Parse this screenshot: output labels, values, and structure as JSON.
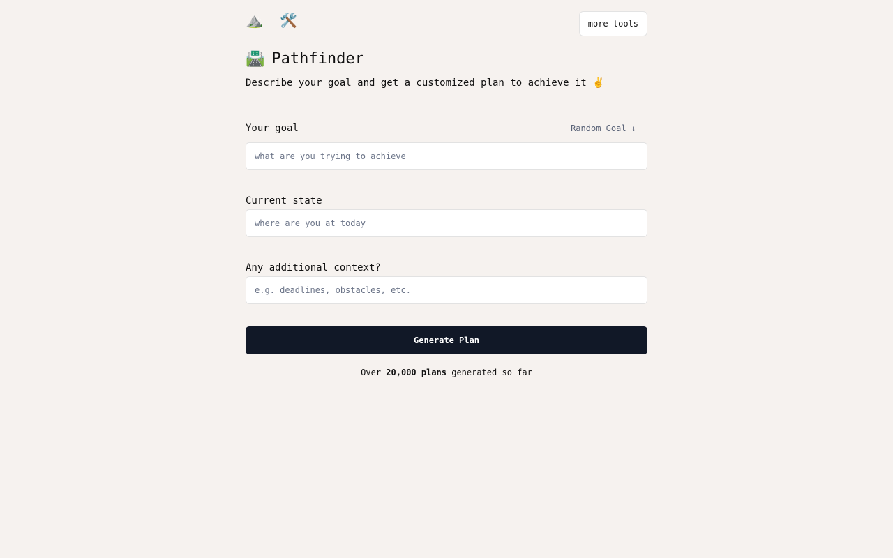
{
  "header": {
    "logo_icons": "⛰️ 🛠️",
    "more_tools_label": "more tools"
  },
  "hero": {
    "title_icon": "🛣️",
    "title": "Pathfinder",
    "subtitle": "Describe your goal and get a customized plan to achieve it ✌️"
  },
  "form": {
    "goal": {
      "label": "Your goal",
      "random_label": "Random Goal ↓",
      "value": "",
      "placeholder": "what are you trying to achieve"
    },
    "current_state": {
      "label": "Current state",
      "value": "",
      "placeholder": "where are you at today"
    },
    "context": {
      "label": "Any additional context?",
      "value": "",
      "placeholder": "e.g. deadlines, obstacles, etc."
    },
    "submit_label": "Generate Plan"
  },
  "stats": {
    "prefix": "Over",
    "count": "20,000 plans",
    "suffix": "generated so far"
  },
  "icons": {
    "logo": "mountain-icon",
    "tools": "tools-icon",
    "title": "road-icon",
    "subtitle": "victory-hand-icon",
    "random": "arrow-down-icon"
  }
}
